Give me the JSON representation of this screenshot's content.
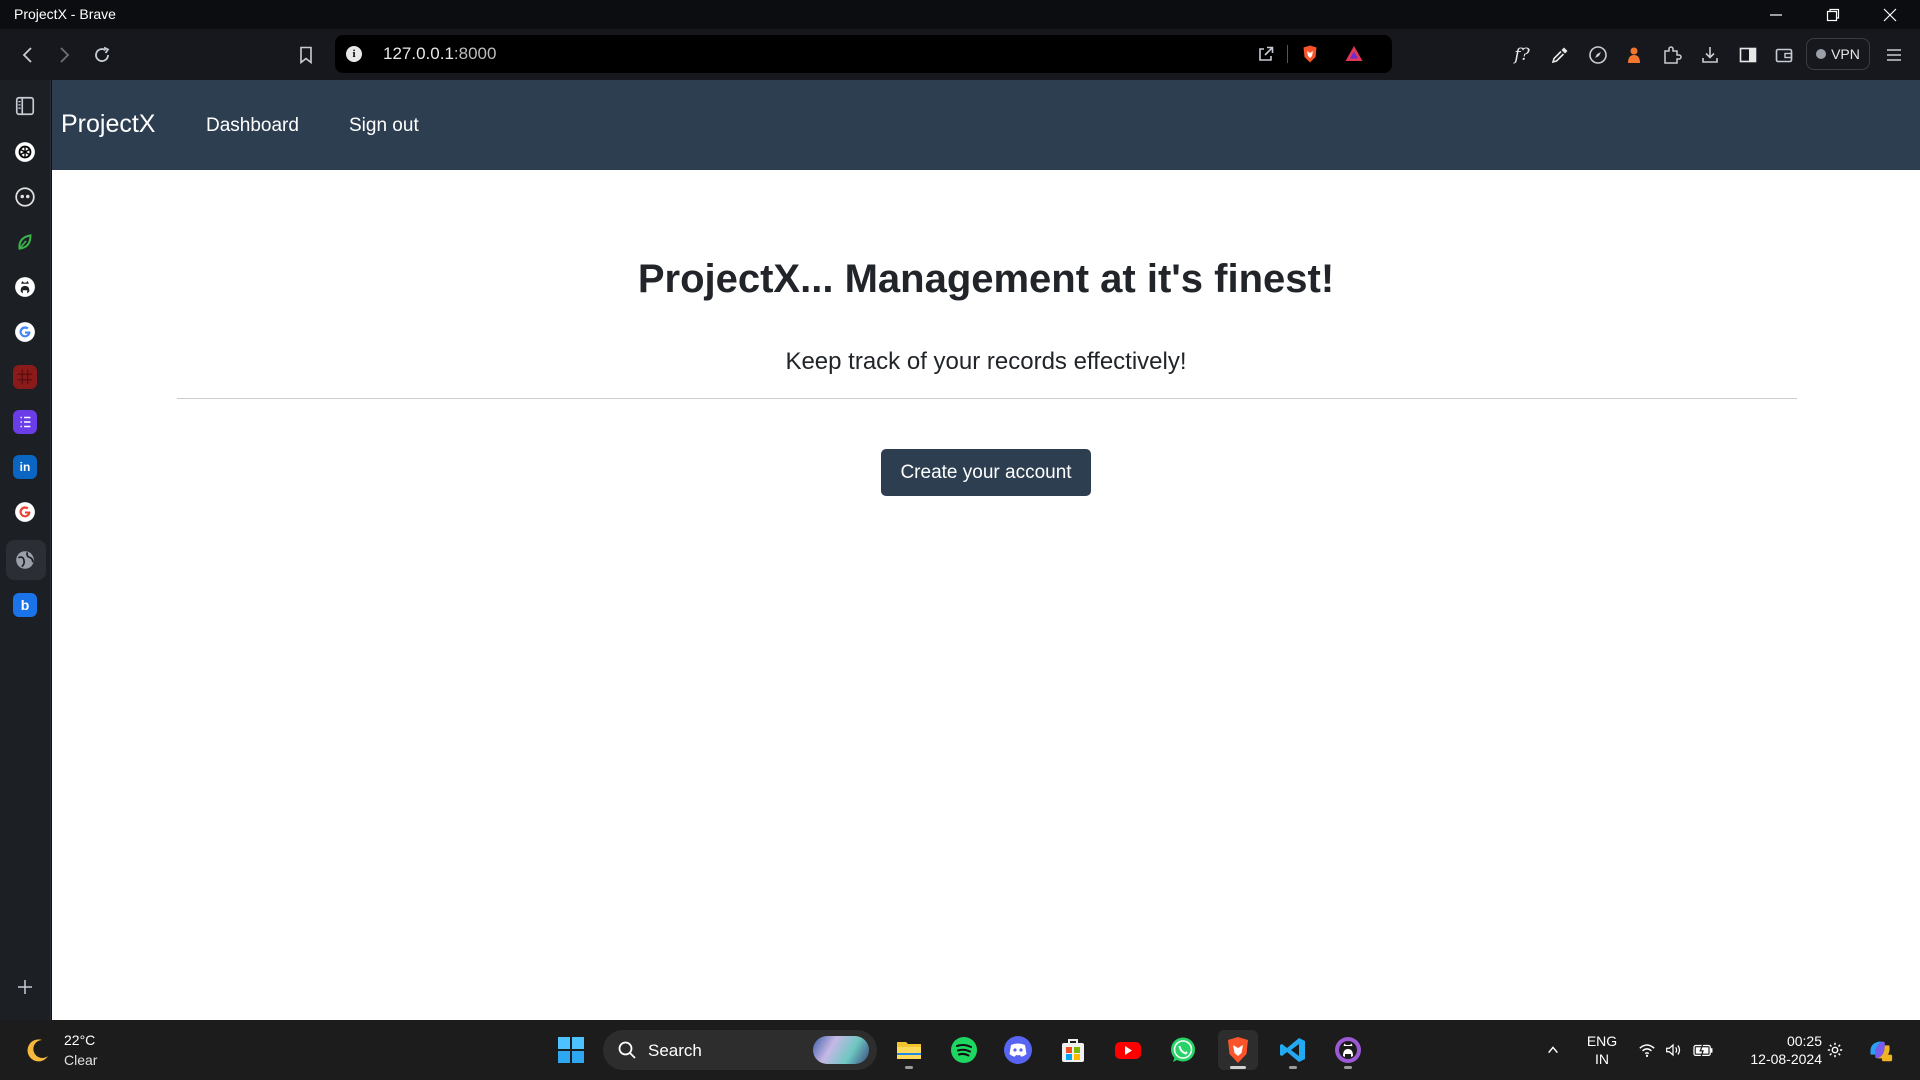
{
  "window": {
    "title": "ProjectX - Brave"
  },
  "browser": {
    "url_host": "127.0.0.1",
    "url_port": ":8000",
    "vpn_label": "VPN",
    "sidebar_items": [
      {
        "name": "chatgpt",
        "icon": "openai-icon",
        "color": "#ffffff"
      },
      {
        "name": "copilot",
        "icon": "github-copilot-icon",
        "color": "#ffffff"
      },
      {
        "name": "ai-green",
        "icon": "leaf-icon",
        "color": "#3bb54a"
      },
      {
        "name": "github",
        "icon": "github-icon",
        "color": "#ffffff"
      },
      {
        "name": "google",
        "icon": "google-icon",
        "color": "#4285f4"
      },
      {
        "name": "red-app",
        "icon": "grid-icon",
        "color": "#8b1a1a"
      },
      {
        "name": "tasks",
        "icon": "list-icon",
        "color": "#6a3de8"
      },
      {
        "name": "linkedin",
        "icon": "linkedin-icon",
        "color": "#0a66c2"
      },
      {
        "name": "google-2",
        "icon": "google-icon",
        "color": "#4285f4"
      },
      {
        "name": "web",
        "icon": "globe-icon",
        "color": "#9aa0a8"
      },
      {
        "name": "bing",
        "icon": "b-icon",
        "color": "#1a73e8"
      }
    ]
  },
  "site": {
    "brand": "ProjectX",
    "nav": {
      "dashboard": "Dashboard",
      "signout": "Sign out"
    },
    "hero": {
      "title": "ProjectX... Management at it's finest!",
      "subtitle": "Keep track of your records effectively!",
      "cta": "Create your account"
    },
    "colors": {
      "navbar": "#2c3e50",
      "button": "#2c3e50"
    }
  },
  "taskbar": {
    "weather_temp": "22°C",
    "weather_cond": "Clear",
    "search_label": "Search",
    "apps": [
      "start",
      "file-explorer",
      "spotify",
      "discord",
      "microsoft-store",
      "youtube",
      "whatsapp",
      "brave",
      "vscode",
      "github-desktop"
    ],
    "lang_top": "ENG",
    "lang_bottom": "IN",
    "time": "00:25",
    "date": "12-08-2024"
  }
}
